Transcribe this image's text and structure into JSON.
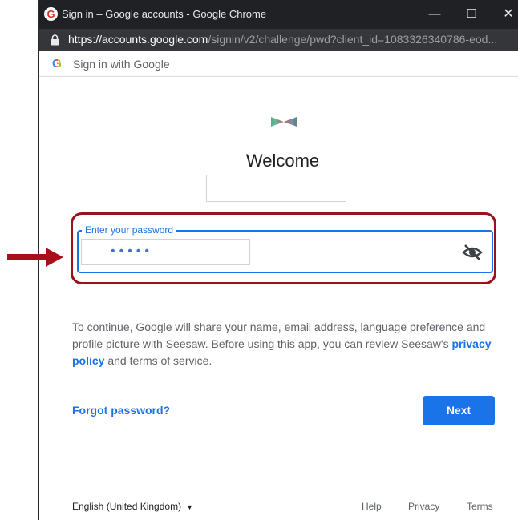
{
  "window": {
    "title": "Sign in – Google accounts - Google Chrome",
    "favicon_letter": "G",
    "controls": {
      "minimize": "—",
      "maximize": "☐",
      "close": "✕"
    }
  },
  "address_bar": {
    "url_base": "https://accounts.google.com",
    "url_rest": "/signin/v2/challenge/pwd?client_id=1083326340786-eod..."
  },
  "page_header": {
    "logo_letter": "G",
    "title": "Sign in with Google"
  },
  "welcome": {
    "heading": "Welcome",
    "app_logo_icon": "seesaw-logo-icon"
  },
  "password": {
    "label": "Enter your password",
    "masked_value": "•••••",
    "visibility_icon": "eye-off-icon"
  },
  "consent": {
    "text_before_link": "To continue, Google will share your name, email address, language preference and profile picture with Seesaw. Before using this app, you can review Seesaw's ",
    "link_text": "privacy policy",
    "text_after_link": " and terms of service."
  },
  "actions": {
    "forgot_password": "Forgot password?",
    "next": "Next"
  },
  "footer": {
    "language": "English (United Kingdom)",
    "language_caret": "▼",
    "help": "Help",
    "privacy": "Privacy",
    "terms": "Terms"
  },
  "colors": {
    "accent": "#1a73e8",
    "highlight": "#9b111e",
    "titlebar": "#202124",
    "addressbar": "#35363a"
  }
}
